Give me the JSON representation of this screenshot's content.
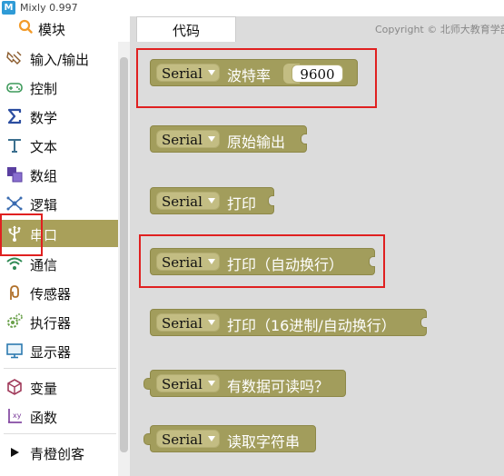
{
  "window": {
    "title": "Mixly 0.997",
    "app_icon_glyph": "M"
  },
  "sidebar": {
    "header_label": "模块",
    "items": [
      {
        "label": "输入/输出",
        "icon": "input-output-icon"
      },
      {
        "label": "控制",
        "icon": "gamepad-icon"
      },
      {
        "label": "数学",
        "icon": "sigma-icon"
      },
      {
        "label": "文本",
        "icon": "text-t-icon"
      },
      {
        "label": "数组",
        "icon": "array-icon"
      },
      {
        "label": "逻辑",
        "icon": "logic-icon"
      },
      {
        "label": "串口",
        "icon": "usb-icon",
        "selected": true
      },
      {
        "label": "通信",
        "icon": "wifi-icon"
      },
      {
        "label": "传感器",
        "icon": "sensor-icon"
      },
      {
        "label": "执行器",
        "icon": "gear-icon"
      },
      {
        "label": "显示器",
        "icon": "monitor-icon"
      },
      {
        "label": "变量",
        "icon": "cube-icon"
      },
      {
        "label": "函数",
        "icon": "function-icon"
      },
      {
        "label": "青橙创客",
        "icon": "play-triangle-icon"
      }
    ]
  },
  "workspace": {
    "tab_label": "代码",
    "copyright": "Copyright © 北师大教育学部i",
    "blocks": [
      {
        "serial": "Serial",
        "text": "波特率",
        "value": "9600"
      },
      {
        "serial": "Serial",
        "text": "原始输出"
      },
      {
        "serial": "Serial",
        "text": "打印"
      },
      {
        "serial": "Serial",
        "text": "打印（自动换行）"
      },
      {
        "serial": "Serial",
        "text": "打印（16进制/自动换行）"
      },
      {
        "serial": "Serial",
        "text": "有数据可读吗？"
      },
      {
        "serial": "Serial",
        "text": "读取字符串"
      }
    ]
  },
  "colors": {
    "block_fill": "#a29d5c",
    "serial_dropdown_fill": "#c3bd83",
    "selected_category": "#a9a05a",
    "highlight_box": "#e02020"
  }
}
